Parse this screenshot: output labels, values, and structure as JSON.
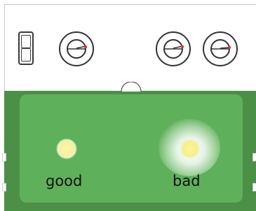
{
  "indicators": [
    {
      "label": "good"
    },
    {
      "label": "bad"
    }
  ],
  "icons": {
    "switch": "toggle-switch-icon",
    "knob": "rotary-knob-icon"
  },
  "colors": {
    "board": "#5fb05a",
    "border_green": "#4c8f47",
    "led": "#f7f19e"
  }
}
